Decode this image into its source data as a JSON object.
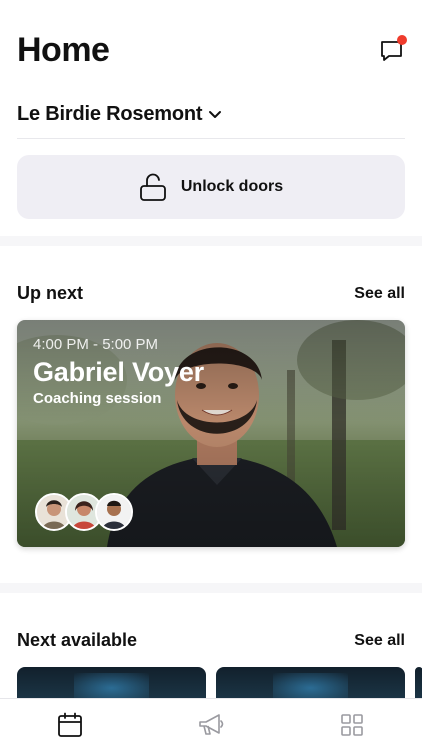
{
  "header": {
    "title": "Home",
    "chat_icon": "chat-bubble-icon",
    "notification_color": "#ef3b2c"
  },
  "location": {
    "name": "Le Birdie Rosemont",
    "icon": "chevron-down-icon"
  },
  "unlock": {
    "label": "Unlock doors",
    "icon": "unlock-icon"
  },
  "up_next": {
    "title": "Up next",
    "see_all": "See all",
    "card": {
      "time": "4:00 PM - 5:00 PM",
      "name": "Gabriel Voyer",
      "type": "Coaching session",
      "participants": [
        "participant-1",
        "participant-2",
        "participant-3"
      ]
    }
  },
  "next_available": {
    "title": "Next available",
    "see_all": "See all"
  },
  "tabbar": {
    "items": [
      {
        "name": "tab-calendar",
        "icon": "calendar-icon",
        "active": true
      },
      {
        "name": "tab-announcements",
        "icon": "megaphone-icon",
        "active": false
      },
      {
        "name": "tab-more",
        "icon": "grid-icon",
        "active": false
      }
    ]
  },
  "colors": {
    "unlock_bg": "#efeef4",
    "active_tab": "#111111",
    "inactive_tab": "#9a9aa0"
  }
}
